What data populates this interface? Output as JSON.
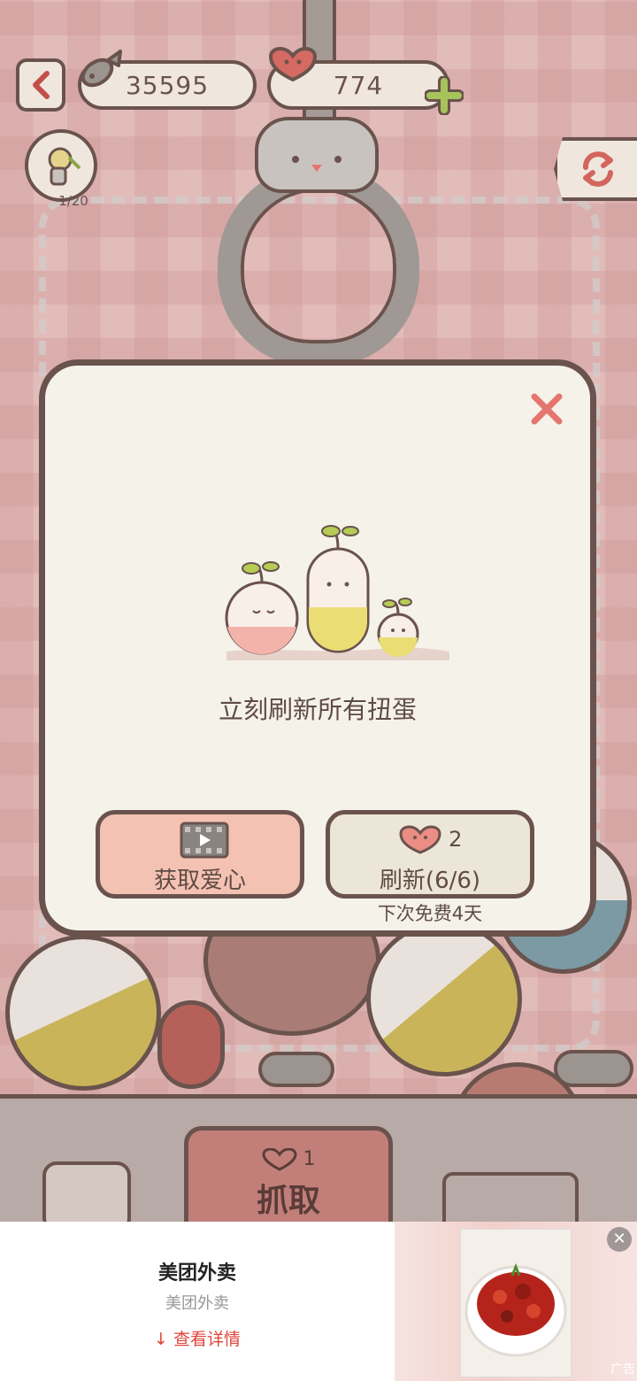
{
  "top_bar": {
    "fish_count": "35595",
    "heart_count": "774"
  },
  "collection": {
    "progress": "1/20"
  },
  "modal": {
    "message": "立刻刷新所有扭蛋",
    "video_button_label": "获取爱心",
    "refresh_cost": "2",
    "refresh_button_label": "刷新(6/6)",
    "next_free_text": "下次免费4天"
  },
  "machine": {
    "grab_cost": "1",
    "grab_label": "抓取"
  },
  "ad": {
    "title": "美团外卖",
    "subtitle": "美团外卖",
    "cta": "查看详情",
    "label": "广告"
  },
  "colors": {
    "outline": "#6a534d",
    "panel": "#f5f2ea",
    "pink_button": "#f4c2b3",
    "heart": "#e5766e",
    "close_x": "#e5766e",
    "ad_cta": "#e0453a"
  }
}
